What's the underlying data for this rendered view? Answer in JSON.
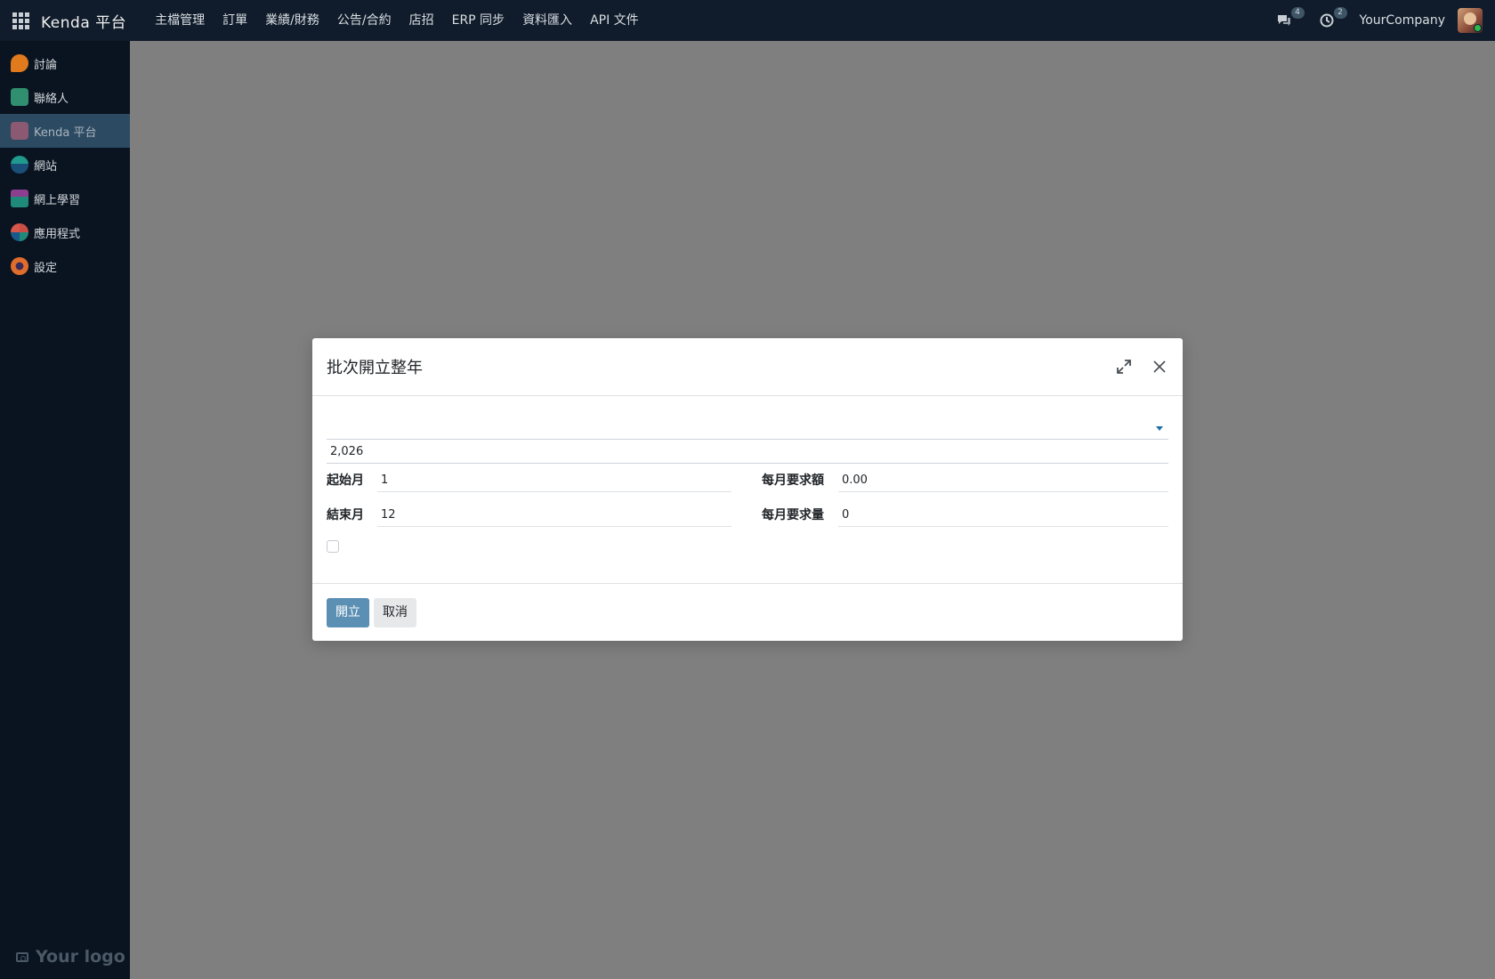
{
  "navbar": {
    "brand": "Kenda 平台",
    "menu": [
      "主檔管理",
      "訂單",
      "業績/財務",
      "公告/合約",
      "店招",
      "ERP 同步",
      "資料匯入",
      "API 文件"
    ],
    "messages_count": "4",
    "activities_count": "2",
    "company": "YourCompany"
  },
  "sidebar": {
    "items": [
      {
        "label": "討論",
        "icon": "discuss-icon",
        "color": "#e07a1c"
      },
      {
        "label": "聯絡人",
        "icon": "contacts-icon",
        "color": "#2f8f6e"
      },
      {
        "label": "Kenda 平台",
        "icon": "kenda-icon",
        "color": "#8b5a72"
      },
      {
        "label": "網站",
        "icon": "website-icon",
        "color": "#1f9a8c"
      },
      {
        "label": "網上學習",
        "icon": "elearning-icon",
        "color": "#1f8a7a"
      },
      {
        "label": "應用程式",
        "icon": "apps-icon",
        "color": "#c94f46"
      },
      {
        "label": "設定",
        "icon": "settings-icon",
        "color": "#e06d2b"
      }
    ],
    "logo_text": "Your logo"
  },
  "dialog": {
    "title": "批次開立整年",
    "year_value": "2,026",
    "start_month_label": "起始月",
    "start_month_value": "1",
    "end_month_label": "結束月",
    "end_month_value": "12",
    "monthly_amount_label": "每月要求額",
    "monthly_amount_value": "0.00",
    "monthly_qty_label": "每月要求量",
    "monthly_qty_value": "0",
    "confirm_label": "開立",
    "cancel_label": "取消"
  }
}
